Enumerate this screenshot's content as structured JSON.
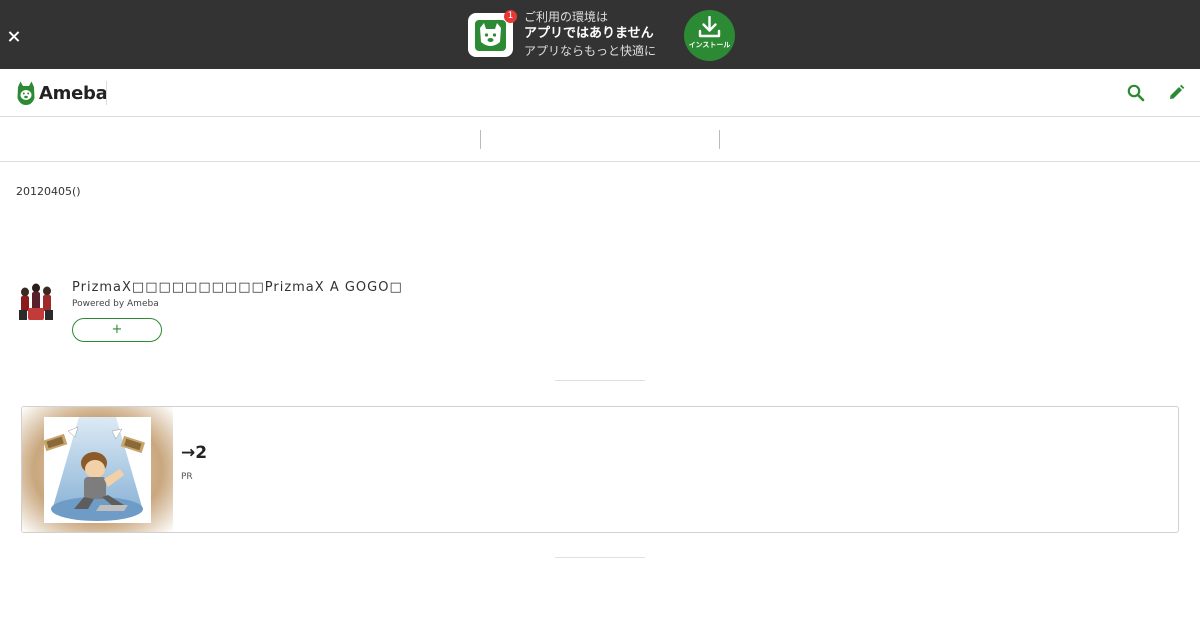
{
  "app_banner": {
    "badge_count": "1",
    "line1": "ご利用の環境は",
    "line2": "アプリではありません",
    "line3": "アプリならもっと快適に",
    "install_label": "インストール"
  },
  "header": {
    "logo_text": "Ameba",
    "brand_color": "#2d8a34",
    "search_icon": "search-icon",
    "edit_icon": "pencil-icon"
  },
  "entry": {
    "date": "20120405()"
  },
  "blog": {
    "title": "PrizmaX□□□□□□□□□□PrizmaX A GOGO□",
    "powered_by": "Powered by Ameba",
    "follow_label": "+"
  },
  "ad": {
    "title": "→2",
    "pr_label": "PR"
  }
}
